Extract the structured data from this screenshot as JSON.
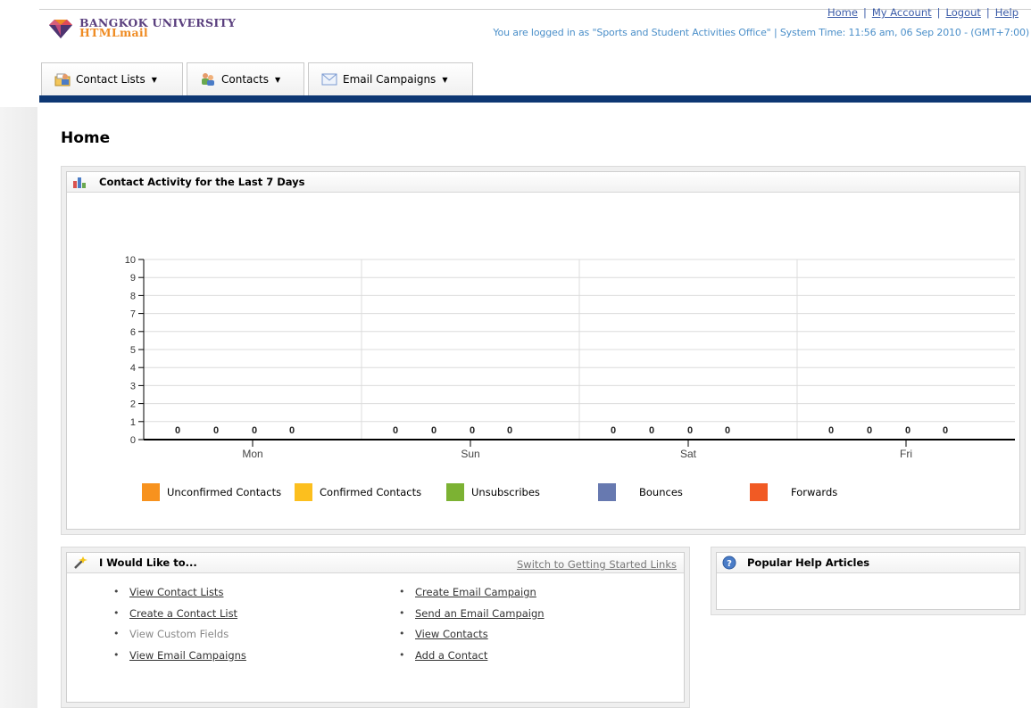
{
  "header": {
    "logo_line1": "BANGKOK UNIVERSITY",
    "logo_line2": "HTMLmail",
    "top_links": [
      "Home",
      "My Account",
      "Logout",
      "Help"
    ],
    "status": "You are logged in as \"Sports and Student Activities Office\" | System Time: 11:56 am, 06 Sep 2010 - (GMT+7:00)"
  },
  "nav": {
    "tabs": [
      {
        "label": "Contact Lists",
        "icon": "contact-lists-icon"
      },
      {
        "label": "Contacts",
        "icon": "contacts-icon"
      },
      {
        "label": "Email Campaigns",
        "icon": "email-icon"
      }
    ],
    "caret": "▼",
    "bar_color": "#0d3773"
  },
  "page": {
    "title": "Home"
  },
  "chart_panel": {
    "title": "Contact Activity for the Last 7 Days",
    "icon": "bar-chart-icon"
  },
  "chart_data": {
    "type": "bar",
    "categories": [
      "Mon",
      "Sun",
      "Sat",
      "Fri"
    ],
    "series": [
      {
        "name": "Unconfirmed Contacts",
        "values": [
          0,
          0,
          0,
          0
        ],
        "color": "#f7921e"
      },
      {
        "name": "Confirmed Contacts",
        "values": [
          0,
          0,
          0,
          0
        ],
        "color": "#fcbf1e"
      },
      {
        "name": "Unsubscribes",
        "values": [
          0,
          0,
          0,
          0
        ],
        "color": "#7cb233"
      },
      {
        "name": "Bounces",
        "values": [
          0,
          0,
          0,
          0
        ],
        "color": "#6779b0"
      },
      {
        "name": "Forwards",
        "values": [
          0,
          0,
          0,
          0
        ],
        "color": "#f15a24"
      }
    ],
    "ylim": [
      0,
      10
    ],
    "yticks": [
      0,
      1,
      2,
      3,
      4,
      5,
      6,
      7,
      8,
      9,
      10
    ],
    "grid": true,
    "legend_position": "bottom"
  },
  "wish_panel": {
    "title": "I Would Like to...",
    "icon": "magic-wand-icon",
    "switch_link": "Switch to Getting Started Links",
    "col1": [
      {
        "label": "View Contact Lists",
        "enabled": true
      },
      {
        "label": "Create a Contact List",
        "enabled": true
      },
      {
        "label": "View Custom Fields",
        "enabled": false
      },
      {
        "label": "View Email Campaigns",
        "enabled": true
      }
    ],
    "col2": [
      {
        "label": "Create Email Campaign",
        "enabled": true
      },
      {
        "label": "Send an Email Campaign",
        "enabled": true
      },
      {
        "label": "View Contacts",
        "enabled": true
      },
      {
        "label": "Add a Contact",
        "enabled": true
      }
    ]
  },
  "help_panel": {
    "title": "Popular Help Articles",
    "icon": "help-icon"
  }
}
